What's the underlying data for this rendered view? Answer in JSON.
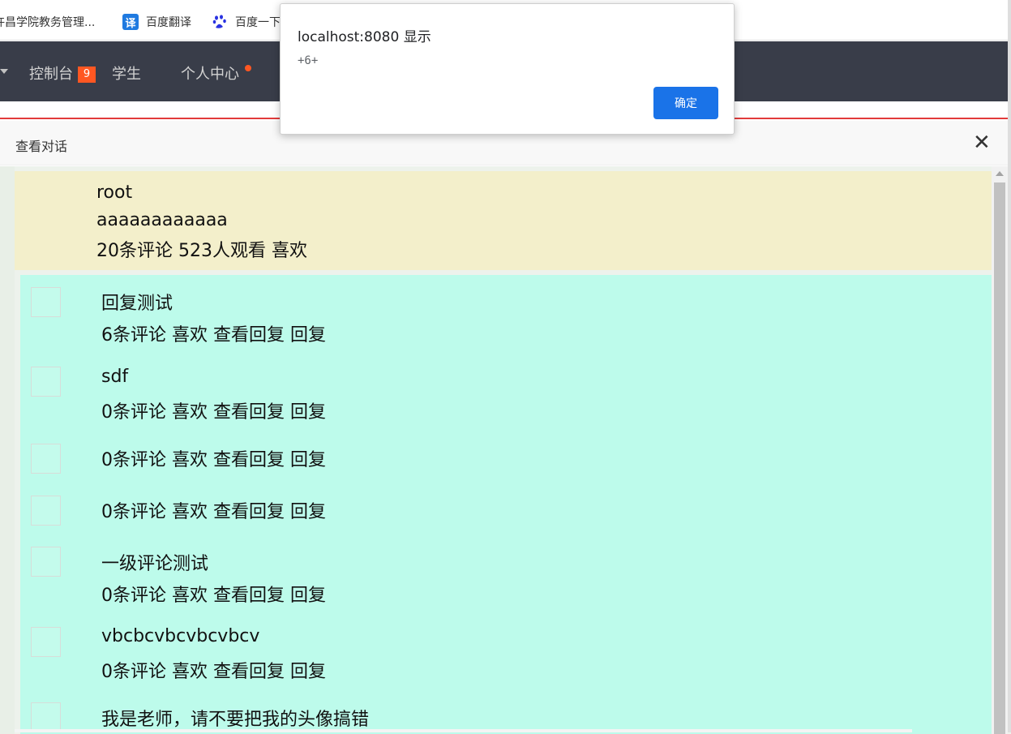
{
  "bookmarks": [
    {
      "label": "许昌学院教务管理...",
      "icon": "none"
    },
    {
      "label": "百度翻译",
      "icon": "translate-icon",
      "glyph": "译"
    },
    {
      "label": "百度一下",
      "icon": "baidu-paw-icon"
    }
  ],
  "nav": {
    "console": "控制台",
    "console_badge": "9",
    "student": "学生",
    "personal": "个人中心"
  },
  "layer": {
    "title": "查看对话",
    "close_glyph": "✕"
  },
  "post": {
    "author": "root",
    "content": "aaaaaaaaaaaa",
    "stats": "20条评论 523人观看 喜欢"
  },
  "replies": [
    {
      "text": "回复测试",
      "actions": "6条评论 喜欢 查看回复 回复"
    },
    {
      "text": "sdf",
      "actions": "0条评论 喜欢 查看回复 回复"
    },
    {
      "text": "",
      "actions": "0条评论 喜欢 查看回复 回复"
    },
    {
      "text": "",
      "actions": "0条评论 喜欢 查看回复 回复"
    },
    {
      "text": "一级评论测试",
      "actions": "0条评论 喜欢 查看回复 回复"
    },
    {
      "text": "vbcbcvbcvbcvbcv",
      "actions": "0条评论 喜欢 查看回复 回复"
    },
    {
      "text": "我是老师，请不要把我的头像搞错",
      "actions": ""
    }
  ],
  "alert": {
    "title": "localhost:8080 显示",
    "message": "+6+",
    "ok_label": "确定"
  },
  "colors": {
    "nav_bg": "#393d49",
    "badge": "#ff5722",
    "post_bg": "#f3efcb",
    "reply_bg": "#bdfbeb",
    "alert_button": "#1a73e8"
  }
}
